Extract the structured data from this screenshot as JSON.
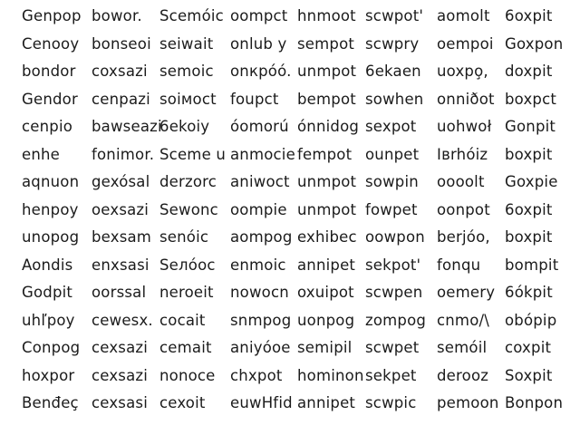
{
  "rows": [
    [
      "Genpop",
      "bowor.",
      "Scemóic",
      "oompct",
      "hnmoot",
      "scwpot'",
      "aomolt",
      "6oxpit"
    ],
    [
      "Cenooy",
      "bonseoi",
      "seiwait",
      "onlub y",
      "sempot",
      "scwpry",
      "oempoi",
      "Goxpon"
    ],
    [
      "bondor",
      "coxsazi",
      "semoic",
      "onкpóó.",
      "unmpot",
      "6ekaen",
      "uoxpo̧,",
      "doxpit"
    ],
    [
      "Gendor",
      "cenpazi",
      "soiмoct",
      "foupct",
      "bempot",
      "sowhen",
      "onniðot",
      "boxpct"
    ],
    [
      "cenpio",
      "bawseazi",
      "6ekoiy",
      "óomorú",
      "ónnidog",
      "sexpot",
      "uohwoł",
      "Gonpit"
    ],
    [
      "enhe",
      "fonimor.",
      "Sceme u",
      "anmocie",
      "fempot",
      "ounpet",
      "Iвrhóiz",
      "boxpit"
    ],
    [
      "aqnuon",
      "gexósal",
      "derzorc",
      "aniwoct",
      "unmpot",
      "sowpin",
      "oooolt",
      "Goxpie"
    ],
    [
      "henpoy",
      "oexsazi",
      "Sewonc",
      "oompie",
      "unmpot",
      "fowpet",
      "oonpot",
      "6oxpit"
    ],
    [
      "unopog",
      "bexsam",
      "senóic",
      "aompog",
      "exhibec",
      "oowpon",
      "berjóo,",
      "boxpit"
    ],
    [
      "Aondis",
      "enxsasi",
      "Seлóoc",
      "enmoic",
      "annipet",
      "sekpot'",
      "fonqu",
      "bompit"
    ],
    [
      "Godpit",
      "oorssal",
      "neroeit",
      "nowocn",
      "oxuipot",
      "scwpen",
      "oemery",
      "6ókpit"
    ],
    [
      "uhľpoy",
      "cewesx.",
      "cocait",
      "snmpog",
      "uonpog",
      "zompog",
      "cnmo/\\",
      "obópip"
    ],
    [
      "Conpog",
      "cexsazi",
      "cemait",
      "aniyóoe",
      "semipil",
      "scwpet",
      "semóil",
      "coxpit"
    ],
    [
      "hoxpor",
      "cexsazi",
      "nonoce",
      "chxpot",
      "hominon",
      "sekpet",
      "derooz",
      "Soxpit"
    ],
    [
      "Benđeç",
      "cexsasi",
      "cexoit",
      "euwHfid",
      "annipet",
      "scwpic",
      "pemoon",
      "Bonpon"
    ]
  ]
}
